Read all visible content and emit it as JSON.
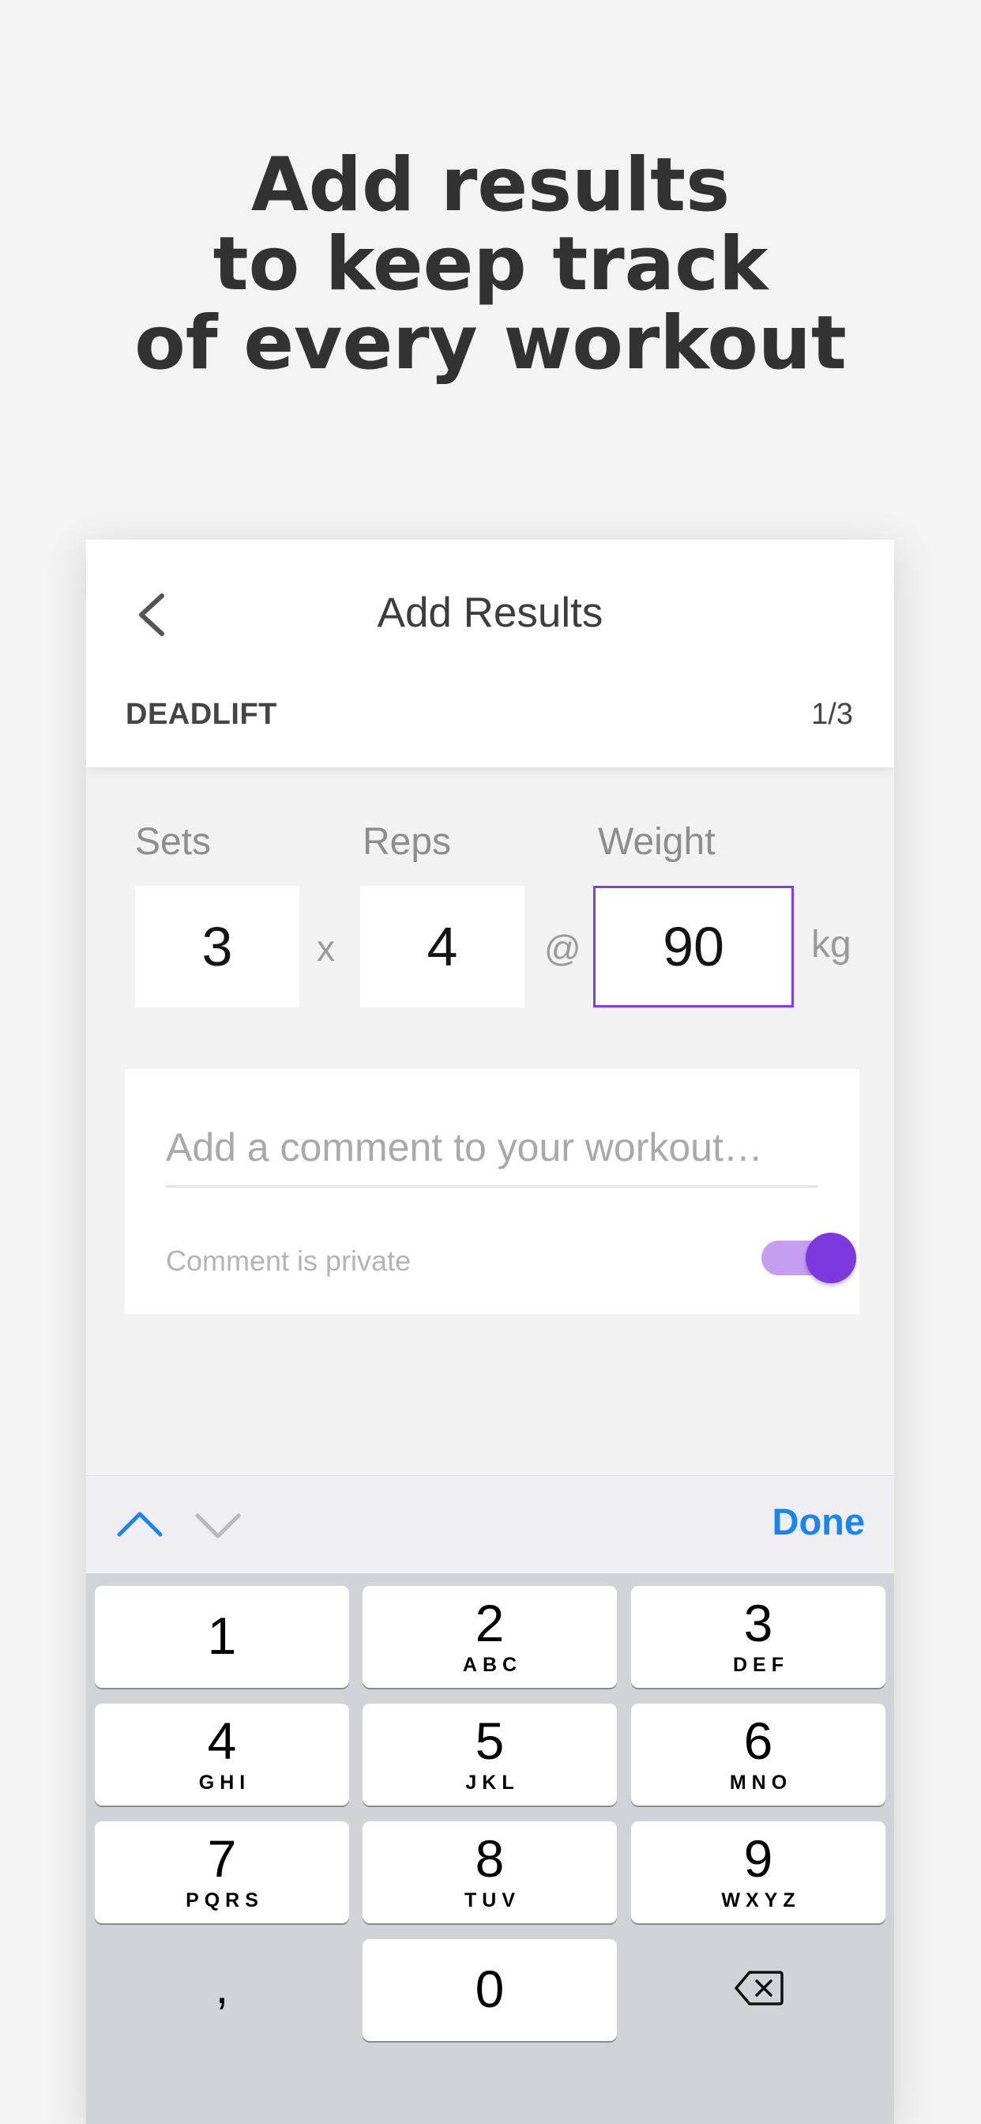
{
  "headline": {
    "line1": "Add results",
    "line2": "to keep track",
    "line3": "of every workout"
  },
  "nav": {
    "title": "Add Results",
    "back_icon": "chevron-left-icon"
  },
  "exercise": {
    "name": "DEADLIFT",
    "progress": "1/3"
  },
  "fields": {
    "sets_label": "Sets",
    "sets_value": "3",
    "times_symbol": "x",
    "reps_label": "Reps",
    "reps_value": "4",
    "at_symbol": "@",
    "weight_label": "Weight",
    "weight_value": "90",
    "unit": "kg"
  },
  "comment": {
    "placeholder": "Add a comment to your workout…",
    "private_label": "Comment is private",
    "private_enabled": true
  },
  "keyboard_toolbar": {
    "prev_icon": "chevron-up-icon",
    "next_icon": "chevron-down-icon",
    "done_label": "Done"
  },
  "keyboard": {
    "keys": [
      {
        "digit": "1",
        "letters": ""
      },
      {
        "digit": "2",
        "letters": "ABC"
      },
      {
        "digit": "3",
        "letters": "DEF"
      },
      {
        "digit": "4",
        "letters": "GHI"
      },
      {
        "digit": "5",
        "letters": "JKL"
      },
      {
        "digit": "6",
        "letters": "MNO"
      },
      {
        "digit": "7",
        "letters": "PQRS"
      },
      {
        "digit": "8",
        "letters": "TUV"
      },
      {
        "digit": "9",
        "letters": "WXYZ"
      },
      {
        "digit": ",",
        "letters": ""
      },
      {
        "digit": "0",
        "letters": ""
      }
    ],
    "delete_icon": "backspace-icon"
  },
  "colors": {
    "accent": "#7f3fe4",
    "toggle_track": "#c49ef1",
    "done_blue": "#1a84f0",
    "page_bg": "#f3f3f4",
    "keyboard_bg": "#d1d3d9"
  }
}
